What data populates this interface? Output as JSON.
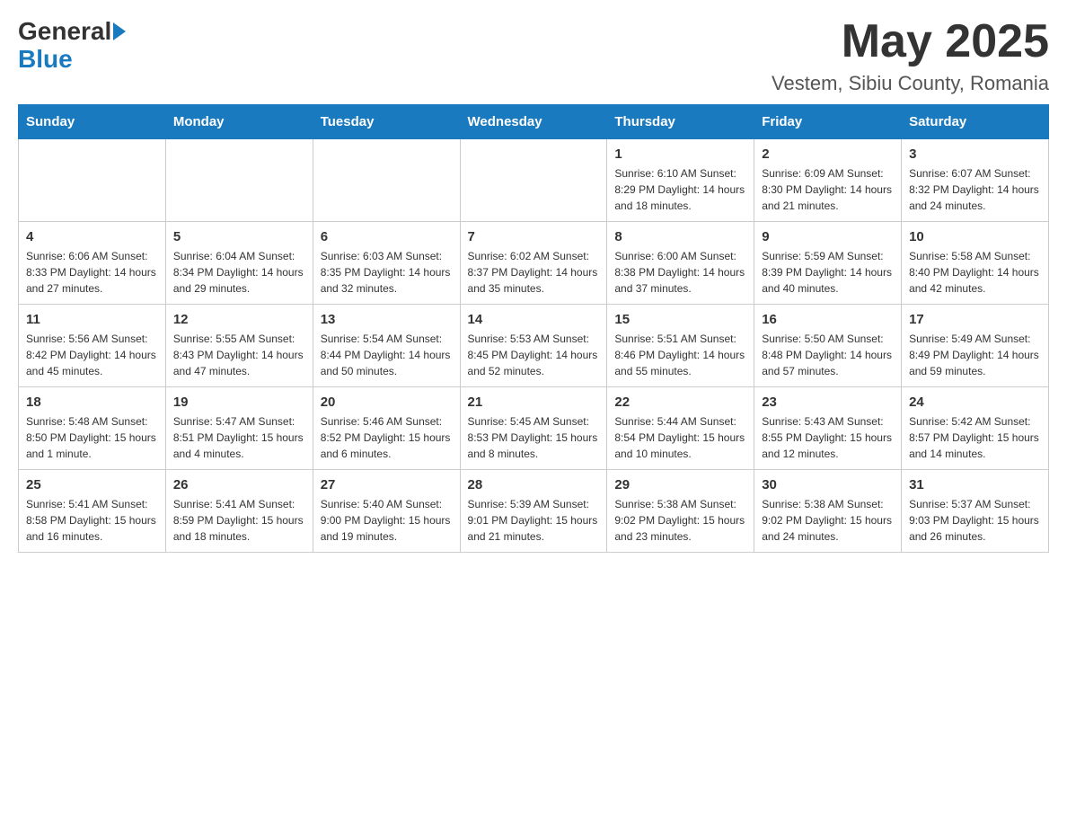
{
  "header": {
    "logo_general": "General",
    "logo_blue": "Blue",
    "month_title": "May 2025",
    "location": "Vestem, Sibiu County, Romania"
  },
  "days_of_week": [
    "Sunday",
    "Monday",
    "Tuesday",
    "Wednesday",
    "Thursday",
    "Friday",
    "Saturday"
  ],
  "weeks": [
    [
      {
        "day": "",
        "info": ""
      },
      {
        "day": "",
        "info": ""
      },
      {
        "day": "",
        "info": ""
      },
      {
        "day": "",
        "info": ""
      },
      {
        "day": "1",
        "info": "Sunrise: 6:10 AM\nSunset: 8:29 PM\nDaylight: 14 hours and 18 minutes."
      },
      {
        "day": "2",
        "info": "Sunrise: 6:09 AM\nSunset: 8:30 PM\nDaylight: 14 hours and 21 minutes."
      },
      {
        "day": "3",
        "info": "Sunrise: 6:07 AM\nSunset: 8:32 PM\nDaylight: 14 hours and 24 minutes."
      }
    ],
    [
      {
        "day": "4",
        "info": "Sunrise: 6:06 AM\nSunset: 8:33 PM\nDaylight: 14 hours and 27 minutes."
      },
      {
        "day": "5",
        "info": "Sunrise: 6:04 AM\nSunset: 8:34 PM\nDaylight: 14 hours and 29 minutes."
      },
      {
        "day": "6",
        "info": "Sunrise: 6:03 AM\nSunset: 8:35 PM\nDaylight: 14 hours and 32 minutes."
      },
      {
        "day": "7",
        "info": "Sunrise: 6:02 AM\nSunset: 8:37 PM\nDaylight: 14 hours and 35 minutes."
      },
      {
        "day": "8",
        "info": "Sunrise: 6:00 AM\nSunset: 8:38 PM\nDaylight: 14 hours and 37 minutes."
      },
      {
        "day": "9",
        "info": "Sunrise: 5:59 AM\nSunset: 8:39 PM\nDaylight: 14 hours and 40 minutes."
      },
      {
        "day": "10",
        "info": "Sunrise: 5:58 AM\nSunset: 8:40 PM\nDaylight: 14 hours and 42 minutes."
      }
    ],
    [
      {
        "day": "11",
        "info": "Sunrise: 5:56 AM\nSunset: 8:42 PM\nDaylight: 14 hours and 45 minutes."
      },
      {
        "day": "12",
        "info": "Sunrise: 5:55 AM\nSunset: 8:43 PM\nDaylight: 14 hours and 47 minutes."
      },
      {
        "day": "13",
        "info": "Sunrise: 5:54 AM\nSunset: 8:44 PM\nDaylight: 14 hours and 50 minutes."
      },
      {
        "day": "14",
        "info": "Sunrise: 5:53 AM\nSunset: 8:45 PM\nDaylight: 14 hours and 52 minutes."
      },
      {
        "day": "15",
        "info": "Sunrise: 5:51 AM\nSunset: 8:46 PM\nDaylight: 14 hours and 55 minutes."
      },
      {
        "day": "16",
        "info": "Sunrise: 5:50 AM\nSunset: 8:48 PM\nDaylight: 14 hours and 57 minutes."
      },
      {
        "day": "17",
        "info": "Sunrise: 5:49 AM\nSunset: 8:49 PM\nDaylight: 14 hours and 59 minutes."
      }
    ],
    [
      {
        "day": "18",
        "info": "Sunrise: 5:48 AM\nSunset: 8:50 PM\nDaylight: 15 hours and 1 minute."
      },
      {
        "day": "19",
        "info": "Sunrise: 5:47 AM\nSunset: 8:51 PM\nDaylight: 15 hours and 4 minutes."
      },
      {
        "day": "20",
        "info": "Sunrise: 5:46 AM\nSunset: 8:52 PM\nDaylight: 15 hours and 6 minutes."
      },
      {
        "day": "21",
        "info": "Sunrise: 5:45 AM\nSunset: 8:53 PM\nDaylight: 15 hours and 8 minutes."
      },
      {
        "day": "22",
        "info": "Sunrise: 5:44 AM\nSunset: 8:54 PM\nDaylight: 15 hours and 10 minutes."
      },
      {
        "day": "23",
        "info": "Sunrise: 5:43 AM\nSunset: 8:55 PM\nDaylight: 15 hours and 12 minutes."
      },
      {
        "day": "24",
        "info": "Sunrise: 5:42 AM\nSunset: 8:57 PM\nDaylight: 15 hours and 14 minutes."
      }
    ],
    [
      {
        "day": "25",
        "info": "Sunrise: 5:41 AM\nSunset: 8:58 PM\nDaylight: 15 hours and 16 minutes."
      },
      {
        "day": "26",
        "info": "Sunrise: 5:41 AM\nSunset: 8:59 PM\nDaylight: 15 hours and 18 minutes."
      },
      {
        "day": "27",
        "info": "Sunrise: 5:40 AM\nSunset: 9:00 PM\nDaylight: 15 hours and 19 minutes."
      },
      {
        "day": "28",
        "info": "Sunrise: 5:39 AM\nSunset: 9:01 PM\nDaylight: 15 hours and 21 minutes."
      },
      {
        "day": "29",
        "info": "Sunrise: 5:38 AM\nSunset: 9:02 PM\nDaylight: 15 hours and 23 minutes."
      },
      {
        "day": "30",
        "info": "Sunrise: 5:38 AM\nSunset: 9:02 PM\nDaylight: 15 hours and 24 minutes."
      },
      {
        "day": "31",
        "info": "Sunrise: 5:37 AM\nSunset: 9:03 PM\nDaylight: 15 hours and 26 minutes."
      }
    ]
  ]
}
